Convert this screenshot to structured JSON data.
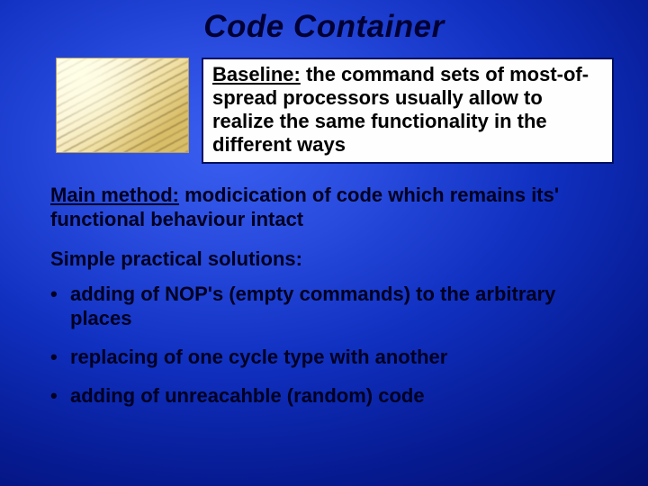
{
  "title": "Code Container",
  "baseline": {
    "label": "Baseline:",
    "text": " the command sets of most-of-spread processors usually allow to realize the same functionality in the different ways"
  },
  "main_method": {
    "label": "Main method:",
    "text": " modicication of code which remains its' functional behaviour intact"
  },
  "solutions_title": "Simple practical solutions:",
  "bullets": [
    "adding of NOP's (empty commands) to the arbitrary places",
    "replacing of one cycle type with another",
    "adding of unreacahble (random) code"
  ]
}
